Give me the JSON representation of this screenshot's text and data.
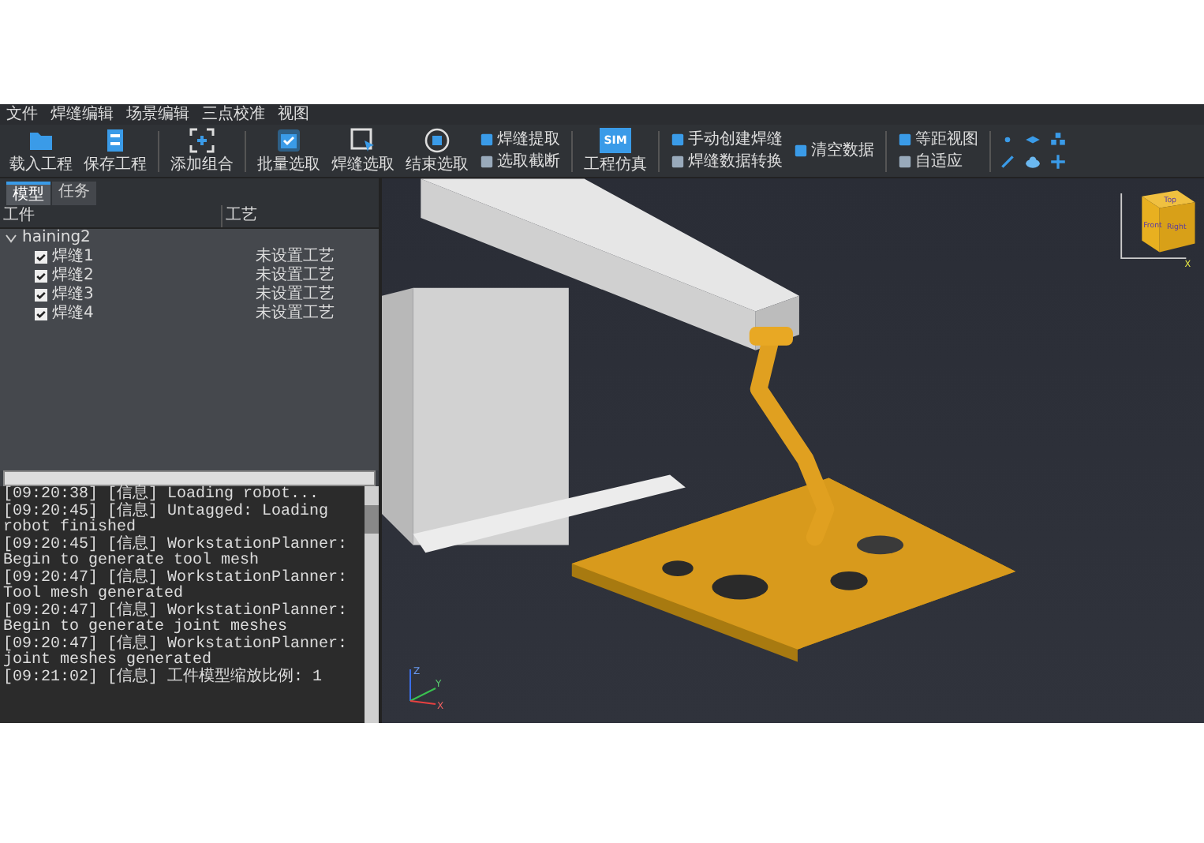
{
  "menu": [
    "文件",
    "焊缝编辑",
    "场景编辑",
    "三点校准",
    "视图"
  ],
  "toolbar": [
    {
      "kind": "large",
      "label": "载入工程"
    },
    {
      "kind": "large",
      "label": "保存工程"
    },
    {
      "kind": "separator"
    },
    {
      "kind": "large",
      "label": "添加组合"
    },
    {
      "kind": "separator"
    },
    {
      "kind": "large",
      "label": "批量选取"
    },
    {
      "kind": "large",
      "label": "焊缝选取"
    },
    {
      "kind": "large",
      "label": "结束选取"
    },
    {
      "kind": "stack",
      "items": [
        "焊缝提取",
        "选取截断"
      ]
    },
    {
      "kind": "separator"
    },
    {
      "kind": "large",
      "label": "工程仿真",
      "icon_text": "SIM"
    },
    {
      "kind": "separator"
    },
    {
      "kind": "stack",
      "items": [
        "手动创建焊缝",
        "焊缝数据转换"
      ]
    },
    {
      "kind": "stack",
      "items": [
        "清空数据"
      ]
    },
    {
      "kind": "separator"
    },
    {
      "kind": "stack",
      "items": [
        "等距视图",
        "自适应"
      ]
    },
    {
      "kind": "separator"
    },
    {
      "kind": "icons"
    }
  ],
  "tabs": [
    {
      "label": "模型",
      "selected": true
    },
    {
      "label": "任务",
      "selected": false
    }
  ],
  "tree": {
    "columns": [
      "工件",
      "工艺"
    ],
    "root": {
      "label": "haining2",
      "expanded": true,
      "children": [
        {
          "label": "焊缝1",
          "checked": true,
          "process": "未设置工艺"
        },
        {
          "label": "焊缝2",
          "checked": true,
          "process": "未设置工艺"
        },
        {
          "label": "焊缝3",
          "checked": true,
          "process": "未设置工艺"
        },
        {
          "label": "焊缝4",
          "checked": true,
          "process": "未设置工艺"
        }
      ]
    }
  },
  "log": [
    "[09:20:38] [信息] Loading robot...",
    "[09:20:45] [信息] Untagged: Loading robot finished",
    "[09:20:45] [信息] WorkstationPlanner: Begin to generate tool mesh",
    "[09:20:47] [信息] WorkstationPlanner: Tool mesh generated",
    "[09:20:47] [信息] WorkstationPlanner: Begin to generate joint meshes",
    "[09:20:47] [信息] WorkstationPlanner: joint meshes generated",
    "[09:21:02] [信息] 工件模型缩放比例: 1"
  ],
  "view_cube": {
    "faces": [
      "Top",
      "Front",
      "Right"
    ],
    "axis_label": "X"
  },
  "axis_triad": {
    "labels": [
      "Z",
      "Y",
      "X"
    ]
  }
}
